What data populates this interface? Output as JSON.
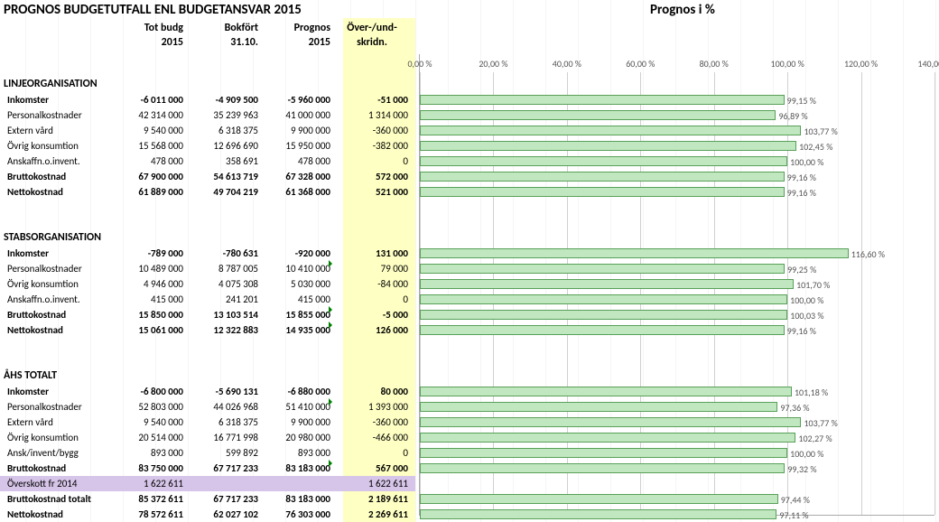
{
  "title_left": "PROGNOS BUDGETUTFALL  ENL BUDGETANSVAR 2015",
  "title_right": "Prognos  i  %",
  "columns": {
    "c1a": "Tot budg",
    "c1b": "2015",
    "c2a": "Bokfört",
    "c2b": "31.10.",
    "c3a": "Prognos",
    "c3b": "2015",
    "c4a": "Över-/und-",
    "c4b": "skridn."
  },
  "sections": [
    {
      "name": "LINJEORGANISATION",
      "rows": [
        {
          "label": "Inkomster",
          "v": [
            "-6 011 000",
            "-4 909 500",
            "-5 960 000",
            "-51 000"
          ],
          "bold": true,
          "bar": 99.15
        },
        {
          "label": "Personalkostnader",
          "v": [
            "42 314 000",
            "35 239 963",
            "41 000 000",
            "1 314 000"
          ],
          "bold": false,
          "bar": 96.89
        },
        {
          "label": "Extern vård",
          "v": [
            "9 540 000",
            "6 318 375",
            "9 900 000",
            "-360 000"
          ],
          "bold": false,
          "bar": 103.77
        },
        {
          "label": "Övrig konsumtion",
          "v": [
            "15 568 000",
            "12 696 690",
            "15 950 000",
            "-382 000"
          ],
          "bold": false,
          "bar": 102.45
        },
        {
          "label": "Anskaffn.o.invent.",
          "v": [
            "478 000",
            "358 691",
            "478 000",
            "0"
          ],
          "bold": false,
          "bar": 100.0
        },
        {
          "label": "Bruttokostnad",
          "v": [
            "67 900 000",
            "54 613 719",
            "67 328 000",
            "572 000"
          ],
          "bold": true,
          "bar": 99.16
        },
        {
          "label": "Nettokostnad",
          "v": [
            "61 889 000",
            "49 704 219",
            "61 368 000",
            "521 000"
          ],
          "bold": true,
          "bar": 99.16
        }
      ]
    },
    {
      "name": "STABSORGANISATION",
      "rows": [
        {
          "label": "Inkomster",
          "v": [
            "-789 000",
            "-780 631",
            "-920 000",
            "131 000"
          ],
          "bold": true,
          "bar": 116.6
        },
        {
          "label": "Personalkostnader",
          "v": [
            "10 489 000",
            "8 787 005",
            "10 410 000",
            "79 000"
          ],
          "bold": false,
          "bar": 99.25,
          "tri3": true
        },
        {
          "label": "Övrig konsumtion",
          "v": [
            "4 946 000",
            "4 075 308",
            "5 030 000",
            "-84 000"
          ],
          "bold": false,
          "bar": 101.7
        },
        {
          "label": "Anskaffn.o.invent.",
          "v": [
            "415 000",
            "241 201",
            "415 000",
            "0"
          ],
          "bold": false,
          "bar": 100.0
        },
        {
          "label": "Bruttokostnad",
          "v": [
            "15 850 000",
            "13 103 514",
            "15 855 000",
            "-5 000"
          ],
          "bold": true,
          "bar": 100.03,
          "tri3": true
        },
        {
          "label": "Nettokostnad",
          "v": [
            "15 061 000",
            "12 322 883",
            "14 935 000",
            "126 000"
          ],
          "bold": true,
          "bar": 99.16,
          "tri3": true
        }
      ]
    },
    {
      "name": "ÅHS TOTALT",
      "rows": [
        {
          "label": "Inkomster",
          "v": [
            "-6 800 000",
            "-5 690 131",
            "-6 880 000",
            "80 000"
          ],
          "bold": true,
          "bar": 101.18
        },
        {
          "label": "Personalkostnader",
          "v": [
            "52 803 000",
            "44 026 968",
            "51 410 000",
            "1 393 000"
          ],
          "bold": false,
          "bar": 97.36,
          "tri3": true
        },
        {
          "label": "Extern vård",
          "v": [
            "9 540 000",
            "6 318 375",
            "9 900 000",
            "-360 000"
          ],
          "bold": false,
          "bar": 103.77
        },
        {
          "label": "Övrig konsumtion",
          "v": [
            "20 514 000",
            "16 771 998",
            "20 980 000",
            "-466 000"
          ],
          "bold": false,
          "bar": 102.27
        },
        {
          "label": "Ansk/invent/bygg",
          "v": [
            "893 000",
            "599 892",
            "893 000",
            "0"
          ],
          "bold": false,
          "bar": 100.0
        },
        {
          "label": "Bruttokostnad",
          "v": [
            "83 750 000",
            "67 717 233",
            "83 183 000",
            "567 000"
          ],
          "bold": true,
          "bar": 99.32,
          "tri3": true
        },
        {
          "label": "Överskott fr 2014",
          "v": [
            "1 622 611",
            "",
            "",
            "1 622 611"
          ],
          "bold": false,
          "bar": null,
          "overskott": true
        },
        {
          "label": "Bruttokostnad totalt",
          "v": [
            "85 372 611",
            "67 717 233",
            "83 183 000",
            "2 189 611"
          ],
          "bold": true,
          "bar": 97.44
        },
        {
          "label": "Nettokostnad",
          "v": [
            "78 572 611",
            "62 027 102",
            "76 303 000",
            "2 269 611"
          ],
          "bold": true,
          "bar": 97.11
        }
      ]
    }
  ],
  "chart_data": {
    "type": "bar",
    "title": "Prognos  i  %",
    "xlabel": "",
    "ylabel": "",
    "xlim": [
      0,
      140
    ],
    "ticks": [
      0,
      20,
      40,
      60,
      80,
      100,
      120,
      140
    ],
    "categories": [
      "LINJE Inkomster",
      "LINJE Personalkostnader",
      "LINJE Extern vård",
      "LINJE Övrig konsumtion",
      "LINJE Anskaffn.o.invent.",
      "LINJE Bruttokostnad",
      "LINJE Nettokostnad",
      "STAB Inkomster",
      "STAB Personalkostnader",
      "STAB Övrig konsumtion",
      "STAB Anskaffn.o.invent.",
      "STAB Bruttokostnad",
      "STAB Nettokostnad",
      "ÅHS Inkomster",
      "ÅHS Personalkostnader",
      "ÅHS Extern vård",
      "ÅHS Övrig konsumtion",
      "ÅHS Ansk/invent/bygg",
      "ÅHS Bruttokostnad",
      "ÅHS Bruttokostnad totalt",
      "ÅHS Nettokostnad"
    ],
    "values": [
      99.15,
      96.89,
      103.77,
      102.45,
      100.0,
      99.16,
      99.16,
      116.6,
      99.25,
      101.7,
      100.0,
      100.03,
      99.16,
      101.18,
      97.36,
      103.77,
      102.27,
      100.0,
      99.32,
      97.44,
      97.11
    ]
  }
}
